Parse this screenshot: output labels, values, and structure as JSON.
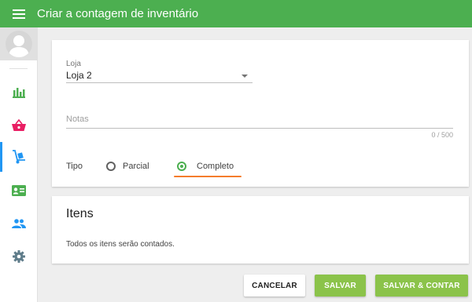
{
  "header": {
    "title": "Criar a contagem de inventário",
    "menu_icon": "hamburger-menu-icon",
    "color": "#4caf50"
  },
  "sidebar": {
    "items": [
      {
        "name": "reports",
        "icon": "bar-chart-icon",
        "color": "#4caf50",
        "active": false
      },
      {
        "name": "sales",
        "icon": "basket-icon",
        "color": "#e91e63",
        "active": false
      },
      {
        "name": "inventory",
        "icon": "hand-truck-icon",
        "color": "#2196f3",
        "active": true
      },
      {
        "name": "customers",
        "icon": "id-card-icon",
        "color": "#4caf50",
        "active": false
      },
      {
        "name": "employees",
        "icon": "people-icon",
        "color": "#2196f3",
        "active": false
      },
      {
        "name": "settings",
        "icon": "gear-icon",
        "color": "#607d8b",
        "active": false
      }
    ]
  },
  "form": {
    "store_label": "Loja",
    "store_value": "Loja 2",
    "notes_placeholder": "Notas",
    "notes_counter": "0 / 500",
    "type_label": "Tipo",
    "type_options": [
      {
        "label": "Parcial",
        "checked": false
      },
      {
        "label": "Completo",
        "checked": true
      }
    ]
  },
  "items_section": {
    "title": "Itens",
    "description": "Todos os itens serão contados."
  },
  "actions": {
    "cancel_label": "CANCELAR",
    "save_label": "SALVAR",
    "save_count_label": "SALVAR & CONTAR"
  },
  "colors": {
    "accent": "#4caf50",
    "button_green": "#8bc34a",
    "highlight": "#f57c2c",
    "active_indicator": "#2196f3"
  }
}
